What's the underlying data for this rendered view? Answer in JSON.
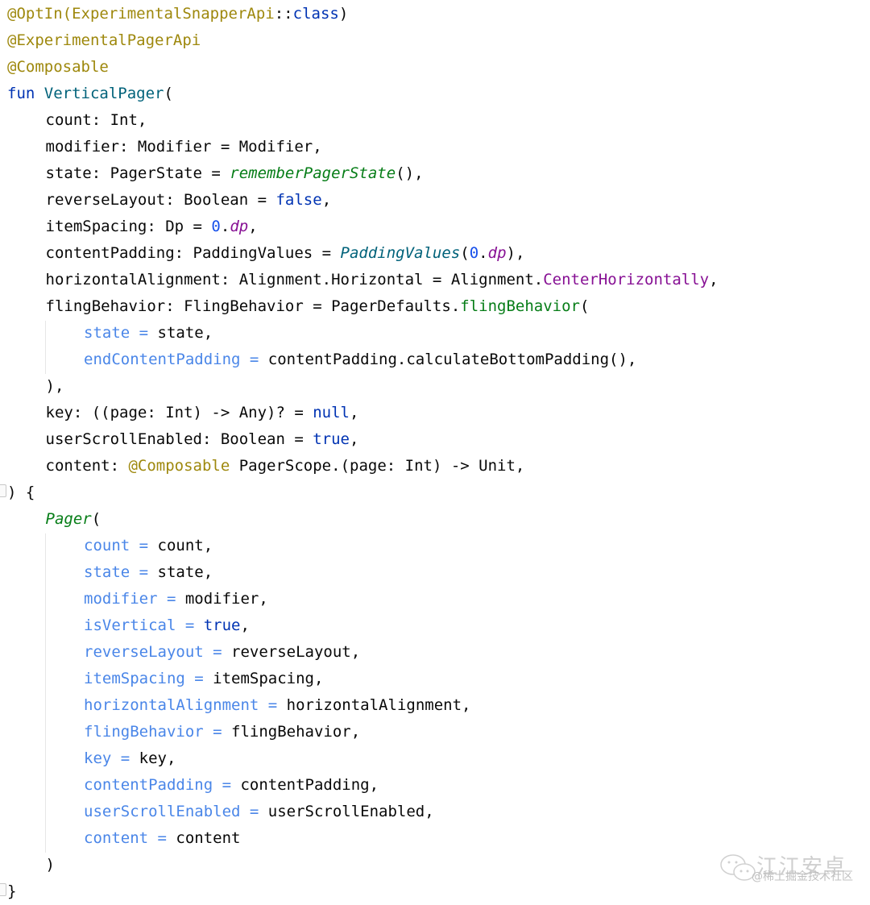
{
  "code": {
    "language": "kotlin",
    "lines": [
      {
        "indent": 0,
        "tokens": [
          {
            "t": "@OptIn(ExperimentalSnapperApi",
            "c": "ann"
          },
          {
            "t": "::",
            "c": "plain"
          },
          {
            "t": "class",
            "c": "kw"
          },
          {
            "t": ")",
            "c": "plain"
          }
        ]
      },
      {
        "indent": 0,
        "tokens": [
          {
            "t": "@ExperimentalPagerApi",
            "c": "ann"
          }
        ]
      },
      {
        "indent": 0,
        "tokens": [
          {
            "t": "@Composable",
            "c": "ann"
          }
        ]
      },
      {
        "indent": 0,
        "tokens": [
          {
            "t": "fun ",
            "c": "kw"
          },
          {
            "t": "VerticalPager",
            "c": "fn"
          },
          {
            "t": "(",
            "c": "plain"
          }
        ]
      },
      {
        "indent": 1,
        "tokens": [
          {
            "t": "count: Int,",
            "c": "plain"
          }
        ]
      },
      {
        "indent": 1,
        "tokens": [
          {
            "t": "modifier: Modifier = Modifier,",
            "c": "plain"
          }
        ]
      },
      {
        "indent": 1,
        "tokens": [
          {
            "t": "state: PagerState = ",
            "c": "plain"
          },
          {
            "t": "rememberPagerState",
            "c": "call"
          },
          {
            "t": "(),",
            "c": "plain"
          }
        ]
      },
      {
        "indent": 1,
        "tokens": [
          {
            "t": "reverseLayout: Boolean = ",
            "c": "plain"
          },
          {
            "t": "false",
            "c": "kw"
          },
          {
            "t": ",",
            "c": "plain"
          }
        ]
      },
      {
        "indent": 1,
        "tokens": [
          {
            "t": "itemSpacing: Dp = ",
            "c": "plain"
          },
          {
            "t": "0",
            "c": "num"
          },
          {
            "t": ".",
            "c": "plain"
          },
          {
            "t": "dp",
            "c": "ext"
          },
          {
            "t": ",",
            "c": "plain"
          }
        ]
      },
      {
        "indent": 1,
        "tokens": [
          {
            "t": "contentPadding: PaddingValues = ",
            "c": "plain"
          },
          {
            "t": "PaddingValues",
            "c": "italic-fn"
          },
          {
            "t": "(",
            "c": "plain"
          },
          {
            "t": "0",
            "c": "num"
          },
          {
            "t": ".",
            "c": "plain"
          },
          {
            "t": "dp",
            "c": "ext"
          },
          {
            "t": "),",
            "c": "plain"
          }
        ]
      },
      {
        "indent": 1,
        "tokens": [
          {
            "t": "horizontalAlignment: Alignment.Horizontal = Alignment.",
            "c": "plain"
          },
          {
            "t": "CenterHorizontally",
            "c": "prop"
          },
          {
            "t": ",",
            "c": "plain"
          }
        ]
      },
      {
        "indent": 1,
        "tokens": [
          {
            "t": "flingBehavior: FlingBehavior = PagerDefaults.",
            "c": "plain"
          },
          {
            "t": "flingBehavior",
            "c": "call2"
          },
          {
            "t": "(",
            "c": "plain"
          }
        ]
      },
      {
        "indent": 2,
        "tokens": [
          {
            "t": "state = ",
            "c": "named"
          },
          {
            "t": "state,",
            "c": "plain"
          }
        ]
      },
      {
        "indent": 2,
        "tokens": [
          {
            "t": "endContentPadding = ",
            "c": "named"
          },
          {
            "t": "contentPadding.calculateBottomPadding(),",
            "c": "plain"
          }
        ]
      },
      {
        "indent": 1,
        "tokens": [
          {
            "t": "),",
            "c": "plain"
          }
        ]
      },
      {
        "indent": 1,
        "tokens": [
          {
            "t": "key: ((page: Int) -> Any)? = ",
            "c": "plain"
          },
          {
            "t": "null",
            "c": "kw"
          },
          {
            "t": ",",
            "c": "plain"
          }
        ]
      },
      {
        "indent": 1,
        "tokens": [
          {
            "t": "userScrollEnabled: Boolean = ",
            "c": "plain"
          },
          {
            "t": "true",
            "c": "kw"
          },
          {
            "t": ",",
            "c": "plain"
          }
        ]
      },
      {
        "indent": 1,
        "tokens": [
          {
            "t": "content: ",
            "c": "plain"
          },
          {
            "t": "@Composable",
            "c": "ann"
          },
          {
            "t": " PagerScope.(page: Int) -> Unit,",
            "c": "plain"
          }
        ]
      },
      {
        "indent": 0,
        "tokens": [
          {
            "t": ") {",
            "c": "plain"
          }
        ]
      },
      {
        "indent": 1,
        "tokens": [
          {
            "t": "Pager",
            "c": "call"
          },
          {
            "t": "(",
            "c": "plain"
          }
        ]
      },
      {
        "indent": 2,
        "tokens": [
          {
            "t": "count = ",
            "c": "named"
          },
          {
            "t": "count,",
            "c": "plain"
          }
        ]
      },
      {
        "indent": 2,
        "tokens": [
          {
            "t": "state = ",
            "c": "named"
          },
          {
            "t": "state,",
            "c": "plain"
          }
        ]
      },
      {
        "indent": 2,
        "tokens": [
          {
            "t": "modifier = ",
            "c": "named"
          },
          {
            "t": "modifier,",
            "c": "plain"
          }
        ]
      },
      {
        "indent": 2,
        "tokens": [
          {
            "t": "isVertical = ",
            "c": "named"
          },
          {
            "t": "true",
            "c": "kw"
          },
          {
            "t": ",",
            "c": "plain"
          }
        ]
      },
      {
        "indent": 2,
        "tokens": [
          {
            "t": "reverseLayout = ",
            "c": "named"
          },
          {
            "t": "reverseLayout,",
            "c": "plain"
          }
        ]
      },
      {
        "indent": 2,
        "tokens": [
          {
            "t": "itemSpacing = ",
            "c": "named"
          },
          {
            "t": "itemSpacing,",
            "c": "plain"
          }
        ]
      },
      {
        "indent": 2,
        "tokens": [
          {
            "t": "horizontalAlignment = ",
            "c": "named"
          },
          {
            "t": "horizontalAlignment,",
            "c": "plain"
          }
        ]
      },
      {
        "indent": 2,
        "tokens": [
          {
            "t": "flingBehavior = ",
            "c": "named"
          },
          {
            "t": "flingBehavior,",
            "c": "plain"
          }
        ]
      },
      {
        "indent": 2,
        "tokens": [
          {
            "t": "key = ",
            "c": "named"
          },
          {
            "t": "key,",
            "c": "plain"
          }
        ]
      },
      {
        "indent": 2,
        "tokens": [
          {
            "t": "contentPadding = ",
            "c": "named"
          },
          {
            "t": "contentPadding,",
            "c": "plain"
          }
        ]
      },
      {
        "indent": 2,
        "tokens": [
          {
            "t": "userScrollEnabled = ",
            "c": "named"
          },
          {
            "t": "userScrollEnabled,",
            "c": "plain"
          }
        ]
      },
      {
        "indent": 2,
        "tokens": [
          {
            "t": "content = ",
            "c": "named"
          },
          {
            "t": "content",
            "c": "plain"
          }
        ]
      },
      {
        "indent": 1,
        "tokens": [
          {
            "t": ")",
            "c": "plain"
          }
        ]
      },
      {
        "indent": 0,
        "tokens": [
          {
            "t": "}",
            "c": "plain"
          }
        ]
      }
    ]
  },
  "colors": {
    "annotation": "#9e880d",
    "keyword": "#0033b3",
    "function_decl": "#00627a",
    "function_call": "#067d17",
    "number": "#1750eb",
    "extension_property": "#871094",
    "named_argument": "#4a86e8",
    "text": "#080808"
  },
  "watermark": {
    "title": "江江安卓",
    "subtitle": "@稀土掘金技术社区",
    "icon": "wechat-icon"
  }
}
